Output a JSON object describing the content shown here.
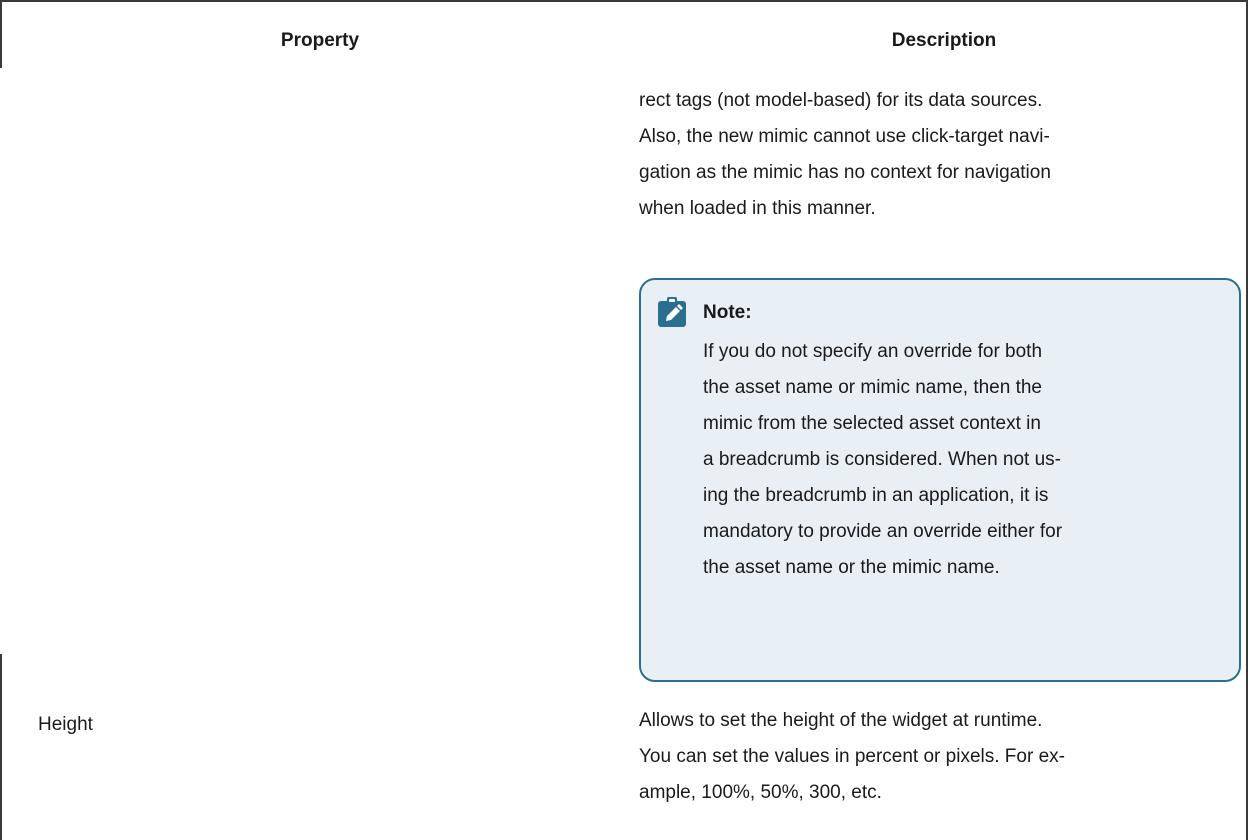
{
  "table": {
    "headers": {
      "property": "Property",
      "description": "Description"
    },
    "continued_description_lines": [
      "rect tags (not model-based) for its data sources.",
      "Also, the new mimic cannot use click-target navi-",
      "gation as the mimic has no context for navigation",
      "when loaded in this manner."
    ],
    "note": {
      "icon": "pencil-clipboard-icon",
      "title": "Note:",
      "lines": [
        "If you do not specify an override for both",
        "the asset name or mimic name, then the",
        "mimic from the selected asset context in",
        "a breadcrumb is considered. When not us-",
        "ing the breadcrumb in an application, it is",
        "mandatory to provide an override either for",
        "the asset name or the mimic name."
      ],
      "accent_color": "#2a6f8f",
      "background_color": "#e8f0f5"
    },
    "rows": [
      {
        "property": "Height",
        "description_lines": [
          "Allows to set the height of the widget at runtime.",
          "You can set the values in percent or pixels. For ex-",
          "ample, 100%, 50%, 300, etc."
        ]
      }
    ]
  }
}
